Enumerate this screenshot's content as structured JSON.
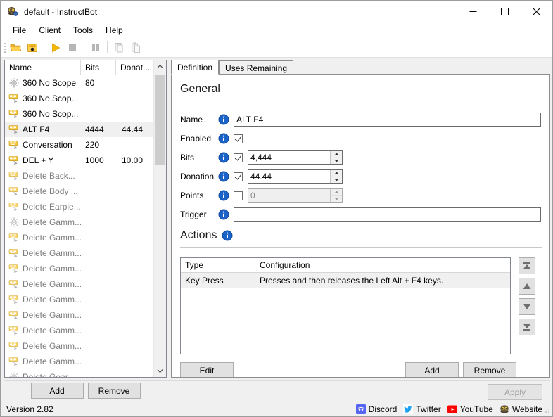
{
  "window": {
    "title": "default - InstructBot",
    "icon": "app-icon",
    "minimize": "—",
    "maximize": "□",
    "close": "✕"
  },
  "menu": {
    "items": [
      {
        "label": "File"
      },
      {
        "label": "Client"
      },
      {
        "label": "Tools"
      },
      {
        "label": "Help"
      }
    ]
  },
  "toolbar": {
    "buttons": [
      {
        "name": "open-icon",
        "title": "Open"
      },
      {
        "name": "save-icon",
        "title": "Save"
      },
      {
        "name": "play-icon",
        "title": "Start"
      },
      {
        "name": "stop-icon",
        "title": "Stop"
      },
      {
        "name": "pause-icon",
        "title": "Pause"
      },
      {
        "name": "copy-icon",
        "title": "Copy"
      },
      {
        "name": "paste-icon",
        "title": "Paste"
      }
    ]
  },
  "command_list": {
    "columns": [
      {
        "key": "name",
        "label": "Name"
      },
      {
        "key": "bits",
        "label": "Bits"
      },
      {
        "key": "donation",
        "label": "Donat..."
      }
    ],
    "sort_indicator": "˄",
    "rows": [
      {
        "icon": "gear-icon",
        "name": "360 No Scope",
        "bits": "80",
        "donation": "",
        "enabled": true,
        "selected": false
      },
      {
        "icon": "keyboard-icon",
        "name": "360 No Scop...",
        "bits": "",
        "donation": "",
        "enabled": true,
        "selected": false
      },
      {
        "icon": "keyboard-icon",
        "name": "360 No Scop...",
        "bits": "",
        "donation": "",
        "enabled": true,
        "selected": false
      },
      {
        "icon": "keyboard-icon",
        "name": "ALT F4",
        "bits": "4444",
        "donation": "44.44",
        "enabled": true,
        "selected": true
      },
      {
        "icon": "keyboard-icon",
        "name": "Conversation",
        "bits": "220",
        "donation": "",
        "enabled": true,
        "selected": false
      },
      {
        "icon": "keyboard-icon",
        "name": "DEL + Y",
        "bits": "1000",
        "donation": "10.00",
        "enabled": true,
        "selected": false
      },
      {
        "icon": "keyboard-icon",
        "name": "Delete Back...",
        "bits": "",
        "donation": "",
        "enabled": false,
        "selected": false
      },
      {
        "icon": "keyboard-icon",
        "name": "Delete Body ...",
        "bits": "",
        "donation": "",
        "enabled": false,
        "selected": false
      },
      {
        "icon": "keyboard-icon",
        "name": "Delete Earpie...",
        "bits": "",
        "donation": "",
        "enabled": false,
        "selected": false
      },
      {
        "icon": "gear-icon",
        "name": "Delete Gamm...",
        "bits": "",
        "donation": "",
        "enabled": false,
        "selected": false
      },
      {
        "icon": "keyboard-icon",
        "name": "Delete Gamm...",
        "bits": "",
        "donation": "",
        "enabled": false,
        "selected": false
      },
      {
        "icon": "keyboard-icon",
        "name": "Delete Gamm...",
        "bits": "",
        "donation": "",
        "enabled": false,
        "selected": false
      },
      {
        "icon": "keyboard-icon",
        "name": "Delete Gamm...",
        "bits": "",
        "donation": "",
        "enabled": false,
        "selected": false
      },
      {
        "icon": "keyboard-icon",
        "name": "Delete Gamm...",
        "bits": "",
        "donation": "",
        "enabled": false,
        "selected": false
      },
      {
        "icon": "keyboard-icon",
        "name": "Delete Gamm...",
        "bits": "",
        "donation": "",
        "enabled": false,
        "selected": false
      },
      {
        "icon": "keyboard-icon",
        "name": "Delete Gamm...",
        "bits": "",
        "donation": "",
        "enabled": false,
        "selected": false
      },
      {
        "icon": "keyboard-icon",
        "name": "Delete Gamm...",
        "bits": "",
        "donation": "",
        "enabled": false,
        "selected": false
      },
      {
        "icon": "keyboard-icon",
        "name": "Delete Gamm...",
        "bits": "",
        "donation": "",
        "enabled": false,
        "selected": false
      },
      {
        "icon": "keyboard-icon",
        "name": "Delete Gamm...",
        "bits": "",
        "donation": "",
        "enabled": false,
        "selected": false
      },
      {
        "icon": "gear-icon",
        "name": "Delete Gear",
        "bits": "",
        "donation": "",
        "enabled": false,
        "selected": false
      }
    ],
    "add_label": "Add",
    "remove_label": "Remove"
  },
  "tabs": [
    {
      "label": "Definition",
      "active": true
    },
    {
      "label": "Uses Remaining",
      "active": false
    }
  ],
  "general": {
    "heading": "General",
    "name": {
      "label": "Name",
      "value": "ALT F4"
    },
    "enabled": {
      "label": "Enabled",
      "checked": true
    },
    "bits": {
      "label": "Bits",
      "checked": true,
      "value": "4,444"
    },
    "donation": {
      "label": "Donation",
      "checked": true,
      "value": "44.44"
    },
    "points": {
      "label": "Points",
      "checked": false,
      "value": "0",
      "disabled": true
    },
    "trigger": {
      "label": "Trigger",
      "value": "",
      "placeholder": ""
    }
  },
  "actions": {
    "heading": "Actions",
    "columns": [
      {
        "key": "type",
        "label": "Type"
      },
      {
        "key": "configuration",
        "label": "Configuration"
      }
    ],
    "rows": [
      {
        "type": "Key Press",
        "configuration": "Presses and then releases the Left Alt + F4 keys."
      }
    ],
    "reorder_buttons": [
      {
        "name": "move-to-top-button",
        "glyph": "top"
      },
      {
        "name": "move-up-button",
        "glyph": "up"
      },
      {
        "name": "move-down-button",
        "glyph": "down"
      },
      {
        "name": "move-to-bottom-button",
        "glyph": "bottom"
      }
    ],
    "edit_label": "Edit",
    "add_label": "Add",
    "remove_label": "Remove"
  },
  "footer": {
    "apply_label": "Apply",
    "apply_enabled": false
  },
  "statusbar": {
    "version": "Version 2.82",
    "links": [
      {
        "label": "Discord",
        "icon": "discord-icon",
        "color": "#5865F2"
      },
      {
        "label": "Twitter",
        "icon": "twitter-icon",
        "color": "#1DA1F2"
      },
      {
        "label": "YouTube",
        "icon": "youtube-icon",
        "color": "#FF0000"
      },
      {
        "label": "Website",
        "icon": "website-icon",
        "color": "#3b3b3b"
      }
    ]
  },
  "colors": {
    "accent_blue": "#0078d7",
    "info_icon_blue": "#1c63c8",
    "selection_gray": "#f0f0f0",
    "toolbar_orange": "#f0a500"
  }
}
